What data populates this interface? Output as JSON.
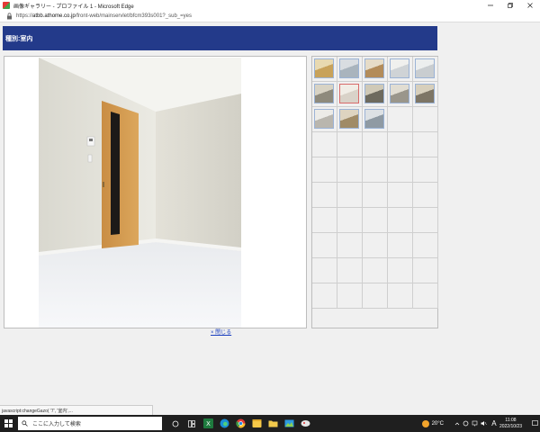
{
  "window": {
    "title": "画像ギャラリー - プロファイル 1 - Microsoft Edge",
    "minimize_icon": "minimize-icon",
    "restore_icon": "restore-icon",
    "close_icon": "close-icon"
  },
  "address": {
    "scheme": "https://",
    "domain": "atbb.athome.co.jp",
    "path": "/front-web/mainservlet/bfcm393s001?_sub_=yes"
  },
  "header": {
    "title": "種別:室内"
  },
  "viewer": {
    "close_label": "× 閉じる"
  },
  "thumbnails": {
    "count": 13,
    "selected_index": 6
  },
  "status": {
    "text": "javascript:changeGazo(             '7',              '室内',..."
  },
  "taskbar": {
    "search_placeholder": "ここに入力して検索",
    "temperature": "20°C",
    "ime": "A",
    "time": "11:08",
    "date": "2022/10/23"
  },
  "colors": {
    "header_bg": "#233a8a",
    "thumb_border": "#9bb3d6",
    "thumb_selected_border": "#d86a6a",
    "taskbar_bg": "#1f1f1f"
  }
}
